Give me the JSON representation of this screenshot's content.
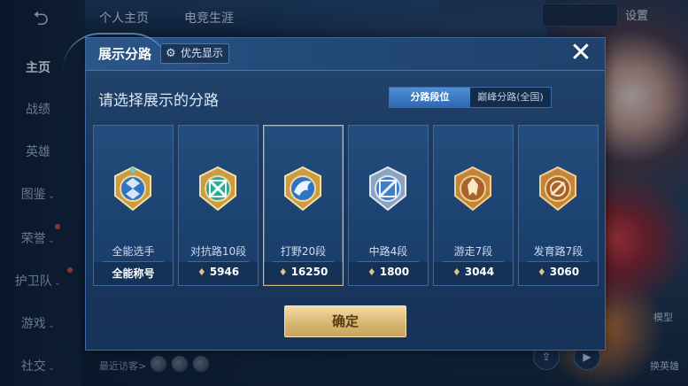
{
  "background": {
    "back_icon": "back-arrow-icon",
    "sidebar": [
      {
        "label": "主页",
        "active": true
      },
      {
        "label": "战绩",
        "active": false
      },
      {
        "label": "英雄",
        "active": false
      },
      {
        "label": "图鉴",
        "active": false,
        "arrow": "⌄"
      },
      {
        "label": "荣誉",
        "active": false,
        "arrow": "⌄"
      },
      {
        "label": "护卫队",
        "active": false,
        "arrow": "⌄"
      },
      {
        "label": "游戏",
        "active": false,
        "arrow": "⌄"
      },
      {
        "label": "社交",
        "active": false,
        "arrow": "⌄"
      }
    ],
    "top_tabs": [
      "个人主页",
      "电竞生涯"
    ],
    "top_right_label": "设置",
    "visitors_label": "最近访客>",
    "model_label": "模型",
    "switch_hero_label": "换英雄"
  },
  "modal": {
    "title": "展示分路",
    "priority_button": "优先显示",
    "close_symbol": "✕",
    "subtitle": "请选择展示的分路",
    "segments": [
      {
        "label": "分路段位",
        "active": true
      },
      {
        "label": "巅峰分路(全国)",
        "active": false
      }
    ],
    "cards": [
      {
        "name": "全能选手",
        "value": "全能称号",
        "show_points_icon": false,
        "selected": false,
        "badge_theme": "gold-blue"
      },
      {
        "name": "对抗路10段",
        "value": "5946",
        "show_points_icon": true,
        "selected": false,
        "badge_theme": "gold-green"
      },
      {
        "name": "打野20段",
        "value": "16250",
        "show_points_icon": true,
        "selected": true,
        "badge_theme": "gold-blue"
      },
      {
        "name": "中路4段",
        "value": "1800",
        "show_points_icon": true,
        "selected": false,
        "badge_theme": "silver-blue"
      },
      {
        "name": "游走7段",
        "value": "3044",
        "show_points_icon": true,
        "selected": false,
        "badge_theme": "bronze"
      },
      {
        "name": "发育路7段",
        "value": "3060",
        "show_points_icon": true,
        "selected": false,
        "badge_theme": "bronze"
      }
    ],
    "confirm_label": "确定"
  },
  "colors": {
    "accent_gold": "#d8b774",
    "panel_blue": "#1b3960",
    "selected_border": "#d6b67a"
  }
}
